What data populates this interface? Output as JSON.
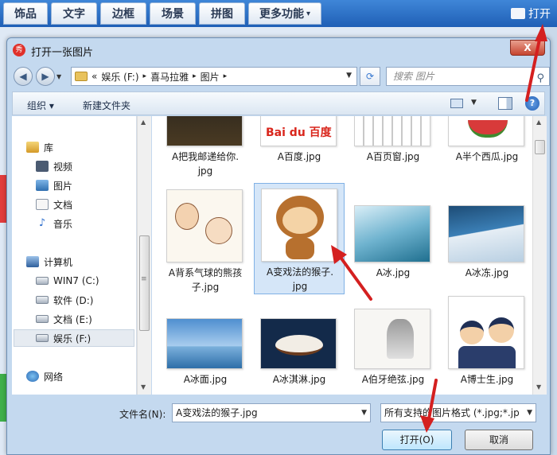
{
  "app_toolbar": {
    "tabs": [
      "饰品",
      "文字",
      "边框",
      "场景",
      "拼图",
      "更多功能"
    ],
    "more_arrow": "▾",
    "open_label": "打开"
  },
  "dialog": {
    "title": "打开一张图片",
    "close_glyph": "X",
    "address": {
      "prefix": "«",
      "segments": [
        "娱乐 (F:)",
        "喜马拉雅",
        "图片"
      ],
      "separator": "▸"
    },
    "search_placeholder": "搜索 图片",
    "toolbar": {
      "organize": "组织 ▾",
      "new_folder": "新建文件夹",
      "help": "?"
    },
    "sidebar": {
      "items": [
        {
          "label": "库",
          "icon": "library-icon",
          "indent": 0
        },
        {
          "label": "视频",
          "icon": "video-icon",
          "indent": 1
        },
        {
          "label": "图片",
          "icon": "pictures-icon",
          "indent": 1
        },
        {
          "label": "文档",
          "icon": "documents-icon",
          "indent": 1
        },
        {
          "label": "音乐",
          "icon": "music-icon",
          "indent": 1
        },
        {
          "label": "计算机",
          "icon": "computer-icon",
          "indent": 0
        },
        {
          "label": "WIN7 (C:)",
          "icon": "drive-icon",
          "indent": 1
        },
        {
          "label": "软件 (D:)",
          "icon": "drive-icon",
          "indent": 1
        },
        {
          "label": "文档 (E:)",
          "icon": "drive-icon",
          "indent": 1
        },
        {
          "label": "娱乐 (F:)",
          "icon": "drive-icon",
          "indent": 1,
          "selected": true
        },
        {
          "label": "网络",
          "icon": "network-icon",
          "indent": 0
        }
      ]
    },
    "files": [
      {
        "name": "A把我邮递给你.jpg",
        "lines": [
          "A把我邮递给你.",
          "jpg"
        ]
      },
      {
        "name": "A百度.jpg",
        "lines": [
          "A百度.jpg"
        ]
      },
      {
        "name": "A百页窗.jpg",
        "lines": [
          "A百页窗.jpg"
        ]
      },
      {
        "name": "A半个西瓜.jpg",
        "lines": [
          "A半个西瓜.jpg"
        ]
      },
      {
        "name": "A背系气球的熊孩子.jpg",
        "lines": [
          "A背系气球的熊孩",
          "子.jpg"
        ]
      },
      {
        "name": "A变戏法的猴子.jpg",
        "lines": [
          "A变戏法的猴子.",
          "jpg"
        ],
        "selected": true
      },
      {
        "name": "A冰.jpg",
        "lines": [
          "A冰.jpg"
        ]
      },
      {
        "name": "A冰冻.jpg",
        "lines": [
          "A冰冻.jpg"
        ]
      },
      {
        "name": "A冰面.jpg",
        "lines": [
          "A冰面.jpg"
        ]
      },
      {
        "name": "A冰淇淋.jpg",
        "lines": [
          "A冰淇淋.jpg"
        ]
      },
      {
        "name": "A伯牙绝弦.jpg",
        "lines": [
          "A伯牙绝弦.jpg"
        ]
      },
      {
        "name": "A博士生.jpg",
        "lines": [
          "A博士生.jpg"
        ]
      }
    ],
    "filename_label": "文件名(N):",
    "filename_value": "A变戏法的猴子.jpg",
    "filter_value": "所有支持的图片格式 (*.jpg;*.jp",
    "open_button": "打开(O)",
    "cancel_button": "取消",
    "baidu_logo_text": "Bai du 百度"
  },
  "colors": {
    "annotation": "#d42020",
    "app_bar": "#2f74c9",
    "selection": "#d5e6f8"
  }
}
